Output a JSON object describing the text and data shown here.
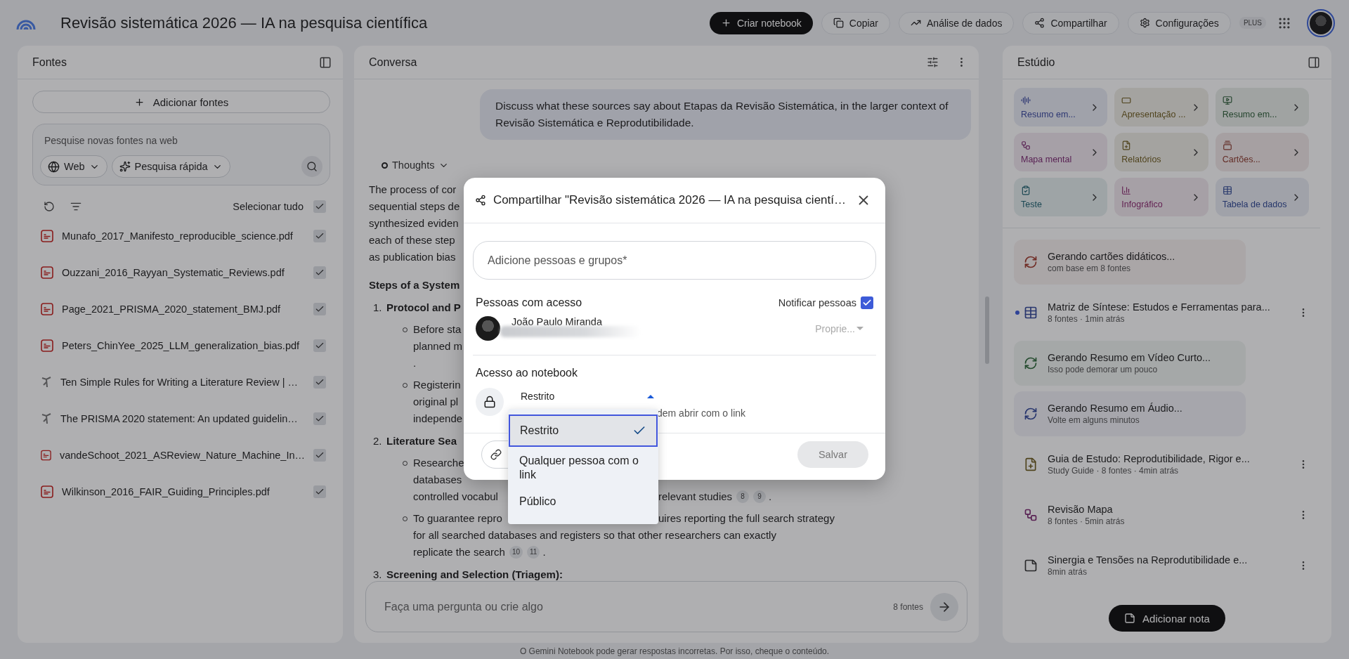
{
  "app": {
    "title": "Revisão sistemática 2026 — IA na pesquisa científica"
  },
  "header_actions": [
    {
      "label": "Criar notebook",
      "kind": "primary"
    },
    {
      "label": "Copiar",
      "kind": "copy"
    },
    {
      "label": "Análise de dados",
      "kind": "chart"
    },
    {
      "label": "Compartilhar",
      "kind": "share"
    },
    {
      "label": "Configurações",
      "kind": "settings"
    }
  ],
  "plan_badge": "PLUS",
  "sources": {
    "title": "Fontes",
    "add_button": "Adicionar fontes",
    "search": {
      "placeholder": "Pesquise novas fontes na web",
      "scope": "Web",
      "mode": "Pesquisa rápida"
    },
    "select_all": {
      "label": "Selecionar tudo",
      "checked": true
    },
    "items": [
      {
        "name": "Munafo_2017_Manifesto_reproducible_science.pdf",
        "kind": "pdf",
        "checked": true
      },
      {
        "name": "Ouzzani_2016_Rayyan_Systematic_Reviews.pdf",
        "kind": "pdf",
        "checked": true
      },
      {
        "name": "Page_2021_PRISMA_2020_statement_BMJ.pdf",
        "kind": "pdf",
        "checked": true
      },
      {
        "name": "Peters_ChinYee_2025_LLM_generalization_bias.pdf",
        "kind": "pdf",
        "checked": true
      },
      {
        "name": "Ten Simple Rules for Writing a Literature Review | …",
        "kind": "web",
        "checked": true
      },
      {
        "name": "The PRISMA 2020 statement: An updated guidelin…",
        "kind": "web",
        "checked": true
      },
      {
        "name": "vandeSchoot_2021_ASReview_Nature_Machine_In…",
        "kind": "pdf",
        "checked": true
      },
      {
        "name": "Wilkinson_2016_FAIR_Guiding_Principles.pdf",
        "kind": "pdf",
        "checked": true
      }
    ]
  },
  "chat": {
    "title": "Conversa",
    "user_message": "Discuss what these sources say about Etapas da Revisão Sistemática, in the larger context of Revisão Sistemática e Reprodutibilidade.",
    "thoughts": "Thoughts",
    "lines": [
      {
        "kind": "para",
        "text": "The process of cor"
      },
      {
        "kind": "para",
        "text": "sequential steps de"
      },
      {
        "kind": "para",
        "text": "synthesized eviden"
      },
      {
        "kind": "para",
        "text": "each of these step"
      },
      {
        "kind": "para",
        "text": "as publication bias"
      },
      {
        "kind": "heading",
        "text": "Steps of a System"
      },
      {
        "kind": "numbered",
        "number": "1.",
        "text": "Protocol and P"
      },
      {
        "kind": "bullet",
        "text": "Before sta"
      },
      {
        "kind": "cont",
        "text": "planned m"
      },
      {
        "kind": "cont",
        "text": "."
      },
      {
        "kind": "bullet",
        "text": "Registerin"
      },
      {
        "kind": "cont",
        "text": "original pl"
      },
      {
        "kind": "cont",
        "text": "independe"
      },
      {
        "kind": "numbered",
        "number": "2.",
        "text": "Literature Sea"
      },
      {
        "kind": "bullet",
        "text": "Researche"
      },
      {
        "kind": "cont",
        "text": "databases"
      },
      {
        "kind": "cont",
        "text": "controlled vocabul",
        "right": "relevant studies",
        "citations": [
          "8",
          "9"
        ],
        "tail": "."
      },
      {
        "kind": "bullet",
        "text": "To guarantee repro",
        "right": "uires reporting the full search strategy"
      },
      {
        "kind": "cont",
        "text": "for all searched databases and registers so that other researchers can exactly"
      },
      {
        "kind": "cont",
        "text": "replicate the search",
        "citations": [
          "10",
          "11"
        ],
        "tail": "."
      },
      {
        "kind": "numbered",
        "number": "3.",
        "text": "Screening and Selection (Triagem):"
      }
    ],
    "input": {
      "placeholder": "Faça uma pergunta ou crie algo",
      "source_count": "8 fontes"
    }
  },
  "studio": {
    "title": "Estúdio",
    "tiles": [
      {
        "label": "Resumo em..."
      },
      {
        "label": "Apresentação ..."
      },
      {
        "label": "Resumo em..."
      },
      {
        "label": "Mapa mental"
      },
      {
        "label": "Relatórios"
      },
      {
        "label": "Cartões..."
      },
      {
        "label": "Teste"
      },
      {
        "label": "Infográfico"
      },
      {
        "label": "Tabela de dados"
      }
    ],
    "items": [
      {
        "kind": "generating",
        "title": "Gerando cartões didáticos...",
        "subtitle": "com base em 8 fontes"
      },
      {
        "kind": "table",
        "title": "Matriz de Síntese: Estudos e Ferramentas para...",
        "subtitle": "8 fontes · 1min atrás",
        "unread": true
      },
      {
        "kind": "generating",
        "title": "Gerando Resumo em Vídeo Curto...",
        "subtitle": "Isso pode demorar um pouco"
      },
      {
        "kind": "generating",
        "title": "Gerando Resumo em Áudio...",
        "subtitle": "Volte em alguns minutos"
      },
      {
        "kind": "guide",
        "title": "Guia de Estudo: Reprodutibilidade, Rigor e...",
        "subtitle": "Study Guide · 8 fontes · 4min atrás",
        "unread": false
      },
      {
        "kind": "mindmap",
        "title": "Revisão Mapa",
        "subtitle": "8 fontes · 5min atrás",
        "unread": false
      },
      {
        "kind": "note",
        "title": "Sinergia e Tensões na Reprodutibilidade e...",
        "subtitle": "8min atrás",
        "unread": false
      }
    ],
    "add_note": "Adicionar nota"
  },
  "disclaimer": "O Gemini Notebook pode gerar respostas incorretas. Por isso, cheque o conteúdo.",
  "share_dialog": {
    "title": "Compartilhar \"Revisão sistemática 2026 — IA na pesquisa cientí…",
    "add_people": {
      "placeholder": "Adicione pessoas e grupos*"
    },
    "people_heading": "Pessoas com acesso",
    "notify": {
      "label": "Notificar pessoas",
      "checked": true
    },
    "people": [
      {
        "name": "João Paulo Miranda",
        "role": "Proprie..."
      }
    ],
    "access_heading": "Acesso ao notebook",
    "access": {
      "value": "Restrito",
      "description": "dem abrir com o link",
      "expanded": true,
      "options": [
        {
          "label": "Restrito",
          "selected": true
        },
        {
          "label": "Qualquer pessoa com o link",
          "selected": false
        },
        {
          "label": "Público",
          "selected": false
        }
      ]
    },
    "save_button": "Salvar"
  }
}
